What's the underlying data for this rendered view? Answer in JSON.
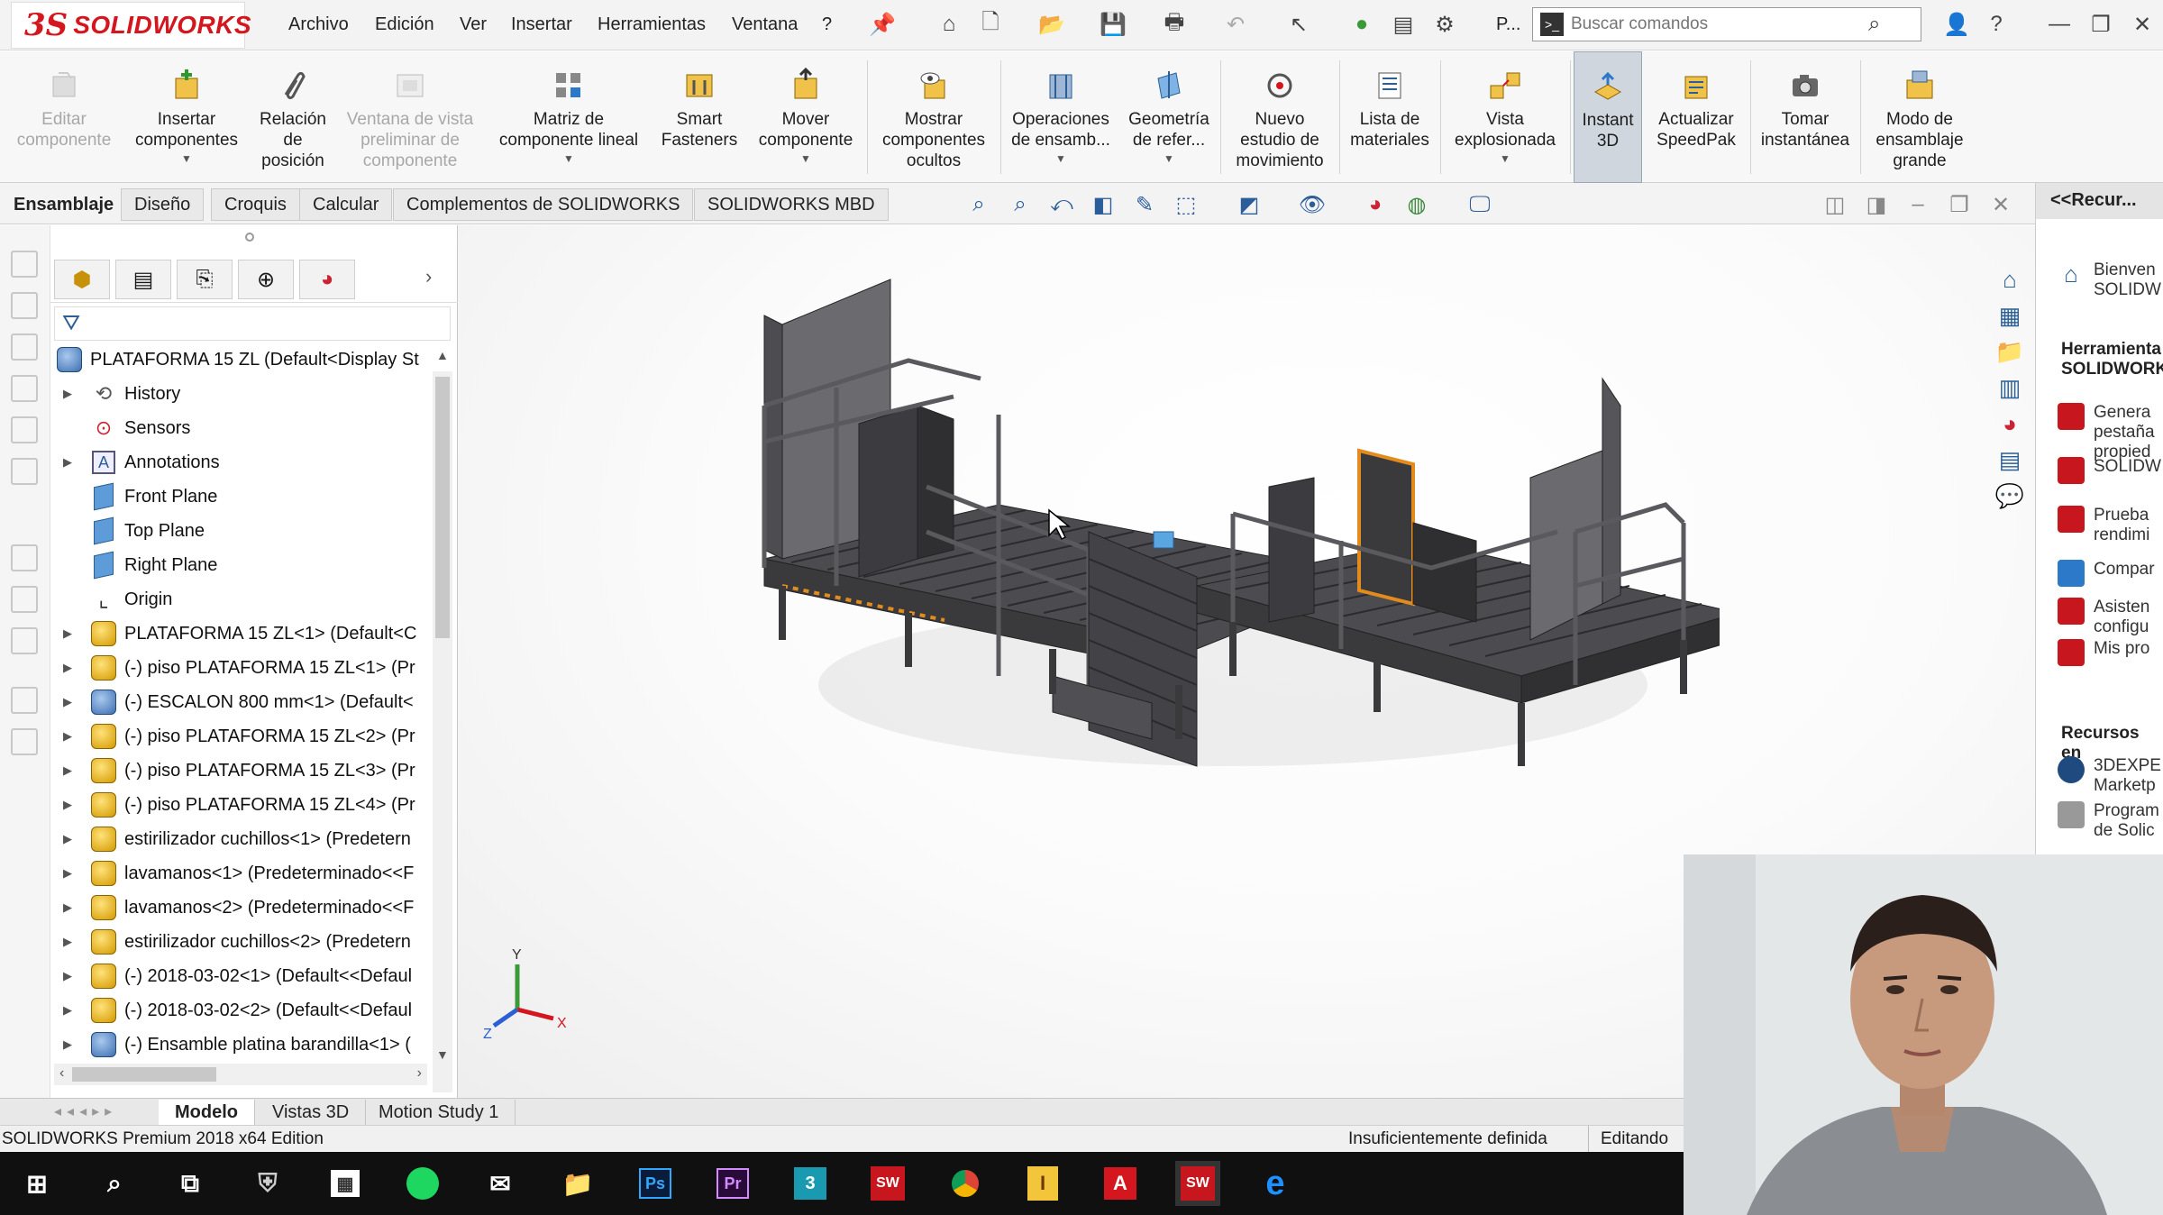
{
  "app": {
    "brand_ds": "3S",
    "brand_name": "SOLIDWORKS"
  },
  "menu": {
    "items": [
      "Archivo",
      "Edición",
      "Ver",
      "Insertar",
      "Herramientas",
      "Ventana",
      "?"
    ],
    "truncated_tool": "P..."
  },
  "search": {
    "placeholder": "Buscar comandos"
  },
  "ribbon": {
    "commands": [
      {
        "label": "Editar\ncomponente",
        "enabled": false
      },
      {
        "label": "Insertar\ncomponentes",
        "enabled": true
      },
      {
        "label": "Relación\nde\nposición",
        "enabled": true
      },
      {
        "label": "Ventana de vista\npreliminar de\ncomponente",
        "enabled": false
      },
      {
        "label": "Matriz de\ncomponente lineal",
        "enabled": true
      },
      {
        "label": "Smart\nFasteners",
        "enabled": true
      },
      {
        "label": "Mover\ncomponente",
        "enabled": true
      },
      {
        "label": "Mostrar\ncomponentes\nocultos",
        "enabled": true
      },
      {
        "label": "Operaciones\nde ensamb...",
        "enabled": true
      },
      {
        "label": "Geometría\nde refer...",
        "enabled": true
      },
      {
        "label": "Nuevo\nestudio de\nmovimiento",
        "enabled": true
      },
      {
        "label": "Lista de\nmateriales",
        "enabled": true
      },
      {
        "label": "Vista\nexplosionada",
        "enabled": true
      },
      {
        "label": "Instant\n3D",
        "enabled": true,
        "active": true
      },
      {
        "label": "Actualizar\nSpeedPak",
        "enabled": true
      },
      {
        "label": "Tomar\ninstantánea",
        "enabled": true
      },
      {
        "label": "Modo de\nensamblaje\ngrande",
        "enabled": true
      }
    ]
  },
  "tabs": [
    "Ensamblaje",
    "Diseño",
    "Croquis",
    "Calcular",
    "Complementos de SOLIDWORKS",
    "SOLIDWORKS MBD"
  ],
  "tree": {
    "root": "PLATAFORMA 15 ZL  (Default<Display St",
    "items": [
      {
        "label": "History",
        "icon": "history-icon",
        "expandable": true
      },
      {
        "label": "Sensors",
        "icon": "sensors-icon",
        "expandable": false
      },
      {
        "label": "Annotations",
        "icon": "annotations-icon",
        "expandable": true
      },
      {
        "label": "Front Plane",
        "icon": "plane-icon",
        "expandable": false
      },
      {
        "label": "Top Plane",
        "icon": "plane-icon",
        "expandable": false
      },
      {
        "label": "Right Plane",
        "icon": "plane-icon",
        "expandable": false
      },
      {
        "label": "Origin",
        "icon": "origin-icon",
        "expandable": false
      },
      {
        "label": "PLATAFORMA 15 ZL<1> (Default<C",
        "icon": "part-icon",
        "expandable": true
      },
      {
        "label": "(-) piso PLATAFORMA 15 ZL<1> (Pr",
        "icon": "part-icon",
        "expandable": true
      },
      {
        "label": "(-) ESCALON 800 mm<1> (Default<",
        "icon": "assembly-icon",
        "expandable": true
      },
      {
        "label": "(-) piso PLATAFORMA 15 ZL<2> (Pr",
        "icon": "part-icon",
        "expandable": true
      },
      {
        "label": "(-) piso PLATAFORMA 15 ZL<3> (Pr",
        "icon": "part-icon",
        "expandable": true
      },
      {
        "label": "(-) piso PLATAFORMA 15 ZL<4> (Pr",
        "icon": "part-icon",
        "expandable": true
      },
      {
        "label": "estirilizador cuchillos<1> (Predetern",
        "icon": "part-icon",
        "expandable": true
      },
      {
        "label": "lavamanos<1> (Predeterminado<<F",
        "icon": "part-icon",
        "expandable": true
      },
      {
        "label": "lavamanos<2> (Predeterminado<<F",
        "icon": "part-icon",
        "expandable": true
      },
      {
        "label": "estirilizador cuchillos<2> (Predetern",
        "icon": "part-icon",
        "expandable": true
      },
      {
        "label": "(-) 2018-03-02<1> (Default<<Defaul",
        "icon": "part-icon",
        "expandable": true
      },
      {
        "label": "(-) 2018-03-02<2> (Default<<Defaul",
        "icon": "part-icon",
        "expandable": true
      },
      {
        "label": "(-) Ensamble platina barandilla<1> (",
        "icon": "assembly-icon",
        "expandable": true
      }
    ]
  },
  "taskpane": {
    "title": "<<Recur...",
    "welcome": "Bienven\nSOLIDW",
    "tools_section": "Herramienta\nSOLIDWORKS",
    "tools": [
      "Genera\npestaña\npropied",
      "SOLIDW",
      "Prueba\nrendimi",
      "Compar",
      "Asisten\nconfigu",
      "Mis pro"
    ],
    "resources_section": "Recursos en",
    "resources": [
      "3DEXPE\nMarketp",
      "Program\nde Solic"
    ]
  },
  "bottom_tabs": [
    "Modelo",
    "Vistas 3D",
    "Motion Study 1"
  ],
  "status": {
    "edition": "SOLIDWORKS Premium 2018 x64 Edition",
    "definition": "Insuficientemente definida",
    "mode": "Editando"
  },
  "taskbar": {
    "apps": [
      "start",
      "search",
      "task-view",
      "shield-app",
      "store",
      "spotify",
      "mail",
      "file-explorer",
      "photoshop",
      "premiere",
      "3d-app",
      "solidworks-2018",
      "chrome",
      "ilustration-app",
      "acrobat",
      "solidworks-2018-active",
      "edge"
    ]
  },
  "colors": {
    "brand_red": "#d4161e",
    "accent_blue": "#2c5f93"
  }
}
